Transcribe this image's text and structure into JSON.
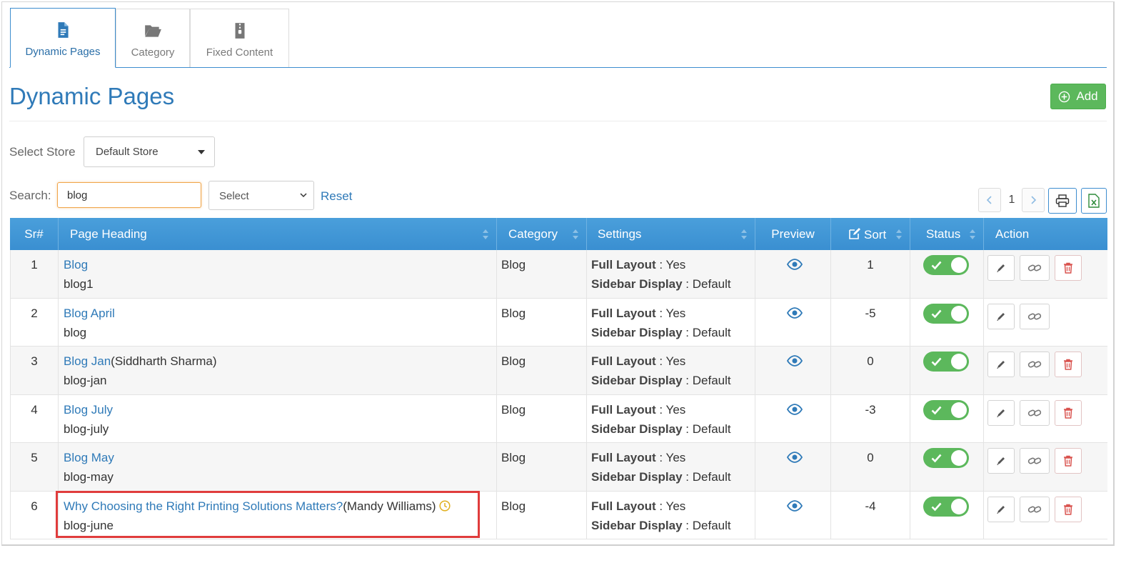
{
  "tabs": [
    {
      "label": "Dynamic Pages",
      "icon": "file-text-icon",
      "active": true
    },
    {
      "label": "Category",
      "icon": "folder-open-icon",
      "active": false
    },
    {
      "label": "Fixed Content",
      "icon": "file-zip-icon",
      "active": false
    }
  ],
  "page": {
    "title": "Dynamic Pages",
    "add_label": "Add"
  },
  "filters": {
    "store_label": "Select Store",
    "store_value": "Default Store",
    "search_label": "Search:",
    "search_value": "blog",
    "select_value": "Select",
    "reset_label": "Reset"
  },
  "pagination": {
    "current": "1"
  },
  "colors": {
    "accent": "#2f7ab8",
    "header": "#3a8fd1",
    "success": "#5cb85c",
    "danger": "#d9534f",
    "highlight": "#e03c3c"
  },
  "table": {
    "headers": {
      "sr": "Sr#",
      "heading": "Page Heading",
      "category": "Category",
      "settings": "Settings",
      "preview": "Preview",
      "sort": "Sort",
      "status": "Status",
      "action": "Action"
    },
    "setting_labels": {
      "full_layout": "Full Layout",
      "sidebar_display": "Sidebar Display"
    },
    "rows": [
      {
        "sr": "1",
        "title": "Blog",
        "author": "",
        "slug": "blog1",
        "category": "Blog",
        "full_layout": ": Yes",
        "sidebar_display": ": Default",
        "sort": "1",
        "status": true,
        "deletable": true
      },
      {
        "sr": "2",
        "title": "Blog April",
        "author": "",
        "slug": "blog",
        "category": "Blog",
        "full_layout": ": Yes",
        "sidebar_display": ": Default",
        "sort": "-5",
        "status": true,
        "deletable": false
      },
      {
        "sr": "3",
        "title": "Blog Jan",
        "author": "(Siddharth Sharma)",
        "slug": "blog-jan",
        "category": "Blog",
        "full_layout": ": Yes",
        "sidebar_display": ": Default",
        "sort": "0",
        "status": true,
        "deletable": true
      },
      {
        "sr": "4",
        "title": "Blog July",
        "author": "",
        "slug": "blog-july",
        "category": "Blog",
        "full_layout": ": Yes",
        "sidebar_display": ": Default",
        "sort": "-3",
        "status": true,
        "deletable": true
      },
      {
        "sr": "5",
        "title": "Blog May",
        "author": "",
        "slug": "blog-may",
        "category": "Blog",
        "full_layout": ": Yes",
        "sidebar_display": ": Default",
        "sort": "0",
        "status": true,
        "deletable": true
      },
      {
        "sr": "6",
        "title": "Why Choosing the Right Printing Solutions Matters?",
        "author": "(Mandy Williams)",
        "slug": "blog-june",
        "category": "Blog",
        "full_layout": ": Yes",
        "sidebar_display": ": Default",
        "sort": "-4",
        "status": true,
        "deletable": true,
        "scheduled": true
      }
    ]
  }
}
